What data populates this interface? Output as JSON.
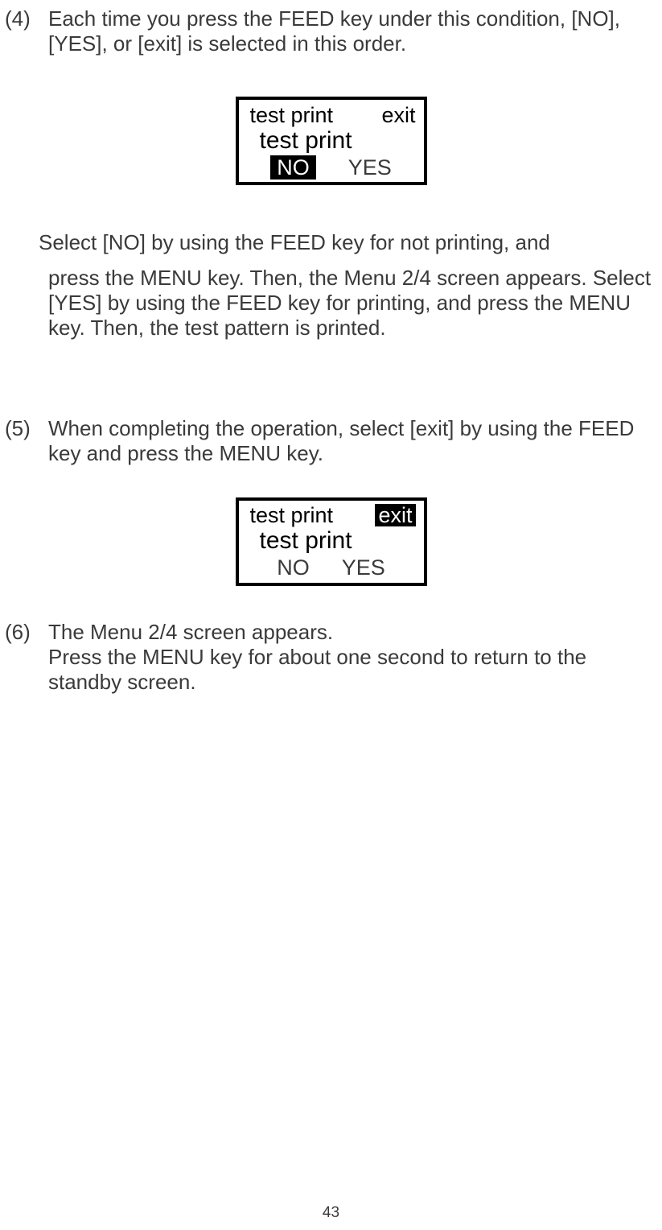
{
  "step4_num": "(4)",
  "step4_text": "Each time you press the FEED key under this condition, [NO], [YES], or [exit] is selected in this order.",
  "lcd1": {
    "top_left": "test print",
    "top_right": "exit",
    "mid": "test print",
    "no": "NO",
    "yes": "YES"
  },
  "step4_follow_a": "Select [NO] by using the FEED key for not printing, and",
  "step4_follow_b": "press the MENU key.  Then, the Menu 2/4 screen appears. Select [YES] by using the FEED key for printing, and press the MENU key.  Then, the test pattern is printed.",
  "step5_num": "(5)",
  "step5_text": "When completing the operation, select [exit] by using the FEED key and press the MENU key.",
  "lcd2": {
    "top_left": "test print",
    "top_right": "exit",
    "mid": "test print",
    "no": "NO",
    "yes": "YES"
  },
  "step6_num": "(6)",
  "step6_line1": "The Menu 2/4 screen appears.",
  "step6_line2": "Press the MENU key for about one second to return to the standby screen.",
  "page_number": "43"
}
